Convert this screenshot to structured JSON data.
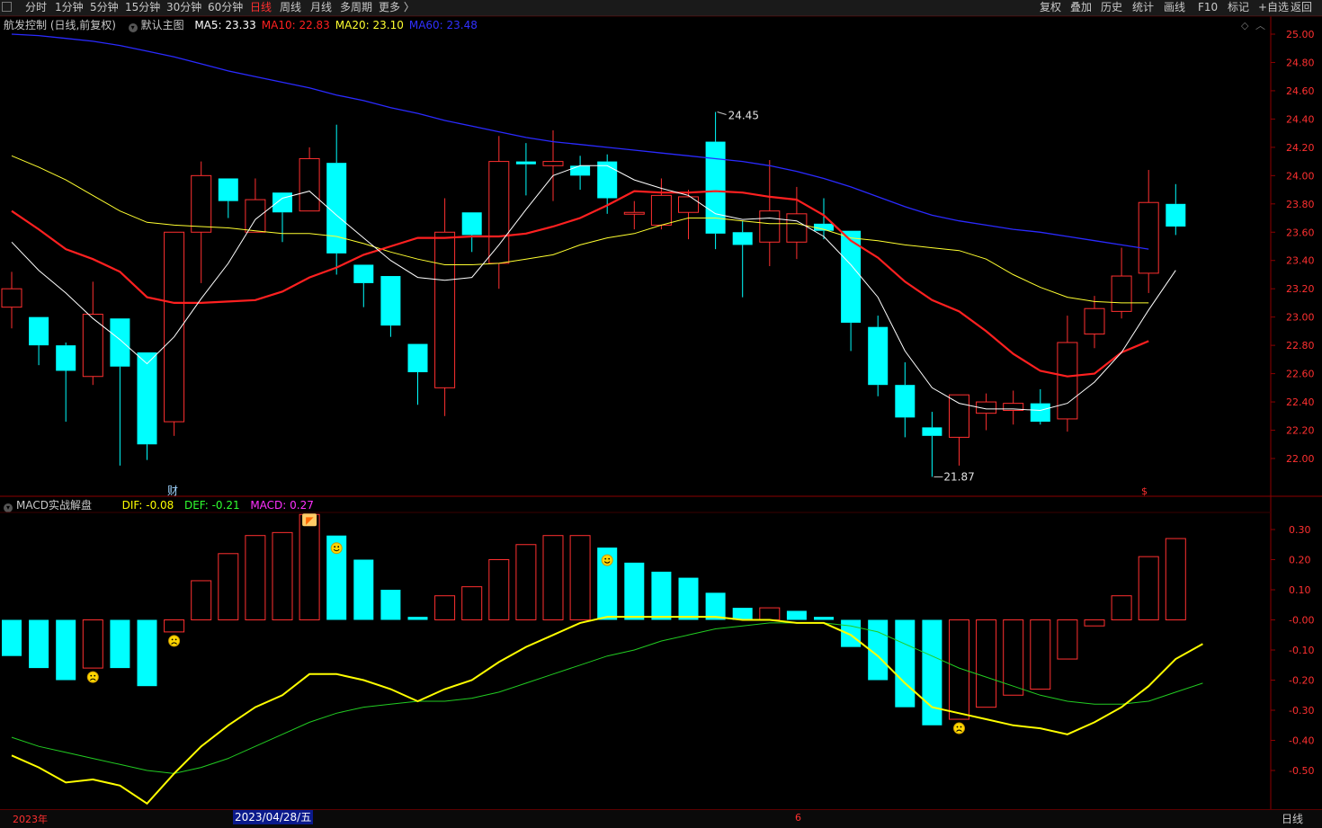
{
  "toolbar": {
    "left_items": [
      "分时",
      "1分钟",
      "5分钟",
      "15分钟",
      "30分钟",
      "60分钟",
      "日线",
      "周线",
      "月线",
      "多周期",
      "更多 〉"
    ],
    "active_index": 6,
    "right_items": [
      "复权",
      "叠加",
      "历史",
      "统计",
      "画线",
      "F10",
      "标记",
      "+自选",
      "返回"
    ]
  },
  "main_header": {
    "title": "航发控制 (日线,前复权)",
    "template": "默认主图",
    "ma": [
      {
        "label": "MA5: 23.33",
        "color": "#ffffff"
      },
      {
        "label": "MA10: 22.83",
        "color": "#ff2020"
      },
      {
        "label": "MA20: 23.10",
        "color": "#ffff30"
      },
      {
        "label": "MA60: 23.48",
        "color": "#3030ff"
      }
    ]
  },
  "sub_header": {
    "title": "MACD实战解盘",
    "dif": "DIF: -0.08",
    "def": "DEF: -0.21",
    "macd": "MACD: 0.27",
    "dif_color": "#ffff00",
    "def_color": "#30ff30",
    "macd_color": "#ff30ff"
  },
  "price_axis": [
    "25.00",
    "24.80",
    "24.60",
    "24.40",
    "24.20",
    "24.00",
    "23.80",
    "23.60",
    "23.40",
    "23.20",
    "23.00",
    "22.80",
    "22.60",
    "22.40",
    "22.20",
    "22.00"
  ],
  "macd_axis": [
    "0.30",
    "0.20",
    "0.10",
    "-0.00",
    "-0.10",
    "-0.20",
    "-0.30",
    "-0.40",
    "-0.50"
  ],
  "annotations": {
    "high": "24.45",
    "low": "21.87",
    "fin_marker": "财",
    "s_marker": "$"
  },
  "bottom_bar": {
    "year": "2023年",
    "cursor_date": "2023/04/28/五",
    "month": "6",
    "period": "日线"
  },
  "colors": {
    "up": "#ff3030",
    "down": "#00ffff",
    "ma5": "#ffffff",
    "ma10": "#ff2020",
    "ma20": "#ffff30",
    "ma60": "#2a2aff",
    "dif": "#ffff00",
    "def": "#22cc22",
    "bg": "#000000",
    "axis": "#8b0000",
    "axis_text": "#ff3030"
  },
  "chart_data": [
    {
      "type": "candlestick",
      "ylim": [
        21.7,
        25.1
      ],
      "candles": [
        {
          "o": 23.07,
          "h": 23.32,
          "l": 22.92,
          "c": 23.2
        },
        {
          "o": 23.0,
          "h": 23.0,
          "l": 22.66,
          "c": 22.8
        },
        {
          "o": 22.8,
          "h": 22.82,
          "l": 22.26,
          "c": 22.62
        },
        {
          "o": 22.58,
          "h": 23.25,
          "l": 22.52,
          "c": 23.02
        },
        {
          "o": 22.99,
          "h": 22.99,
          "l": 21.95,
          "c": 22.65
        },
        {
          "o": 22.75,
          "h": 22.75,
          "l": 21.99,
          "c": 22.1
        },
        {
          "o": 22.26,
          "h": 23.6,
          "l": 22.16,
          "c": 23.6
        },
        {
          "o": 23.6,
          "h": 24.1,
          "l": 23.24,
          "c": 24.0
        },
        {
          "o": 23.98,
          "h": 23.98,
          "l": 23.7,
          "c": 23.82
        },
        {
          "o": 23.6,
          "h": 23.98,
          "l": 23.6,
          "c": 23.83
        },
        {
          "o": 23.88,
          "h": 23.88,
          "l": 23.53,
          "c": 23.74
        },
        {
          "o": 23.75,
          "h": 24.2,
          "l": 23.75,
          "c": 24.12
        },
        {
          "o": 24.09,
          "h": 24.36,
          "l": 23.3,
          "c": 23.45
        },
        {
          "o": 23.37,
          "h": 23.37,
          "l": 23.07,
          "c": 23.24
        },
        {
          "o": 23.29,
          "h": 23.29,
          "l": 22.86,
          "c": 22.94
        },
        {
          "o": 22.81,
          "h": 22.81,
          "l": 22.38,
          "c": 22.61
        },
        {
          "o": 22.5,
          "h": 23.84,
          "l": 22.3,
          "c": 23.6
        },
        {
          "o": 23.74,
          "h": 23.74,
          "l": 23.46,
          "c": 23.58
        },
        {
          "o": 23.38,
          "h": 24.28,
          "l": 23.2,
          "c": 24.1
        },
        {
          "o": 24.1,
          "h": 24.23,
          "l": 23.86,
          "c": 24.08
        },
        {
          "o": 24.07,
          "h": 24.32,
          "l": 23.82,
          "c": 24.1
        },
        {
          "o": 24.07,
          "h": 24.14,
          "l": 23.9,
          "c": 24.0
        },
        {
          "o": 24.1,
          "h": 24.15,
          "l": 23.73,
          "c": 23.84
        },
        {
          "o": 23.73,
          "h": 23.82,
          "l": 23.62,
          "c": 23.74
        },
        {
          "o": 23.65,
          "h": 23.98,
          "l": 23.62,
          "c": 23.86
        },
        {
          "o": 23.74,
          "h": 23.9,
          "l": 23.55,
          "c": 23.85
        },
        {
          "o": 24.24,
          "h": 24.45,
          "l": 23.48,
          "c": 23.59
        },
        {
          "o": 23.6,
          "h": 23.68,
          "l": 23.14,
          "c": 23.51
        },
        {
          "o": 23.53,
          "h": 24.11,
          "l": 23.36,
          "c": 23.75
        },
        {
          "o": 23.53,
          "h": 23.92,
          "l": 23.41,
          "c": 23.73
        },
        {
          "o": 23.66,
          "h": 23.84,
          "l": 23.55,
          "c": 23.61
        },
        {
          "o": 23.61,
          "h": 23.61,
          "l": 22.76,
          "c": 22.96
        },
        {
          "o": 22.93,
          "h": 23.01,
          "l": 22.44,
          "c": 22.52
        },
        {
          "o": 22.52,
          "h": 22.68,
          "l": 22.15,
          "c": 22.29
        },
        {
          "o": 22.22,
          "h": 22.33,
          "l": 21.87,
          "c": 22.16
        },
        {
          "o": 22.15,
          "h": 22.45,
          "l": 21.95,
          "c": 22.45
        },
        {
          "o": 22.32,
          "h": 22.46,
          "l": 22.2,
          "c": 22.4
        },
        {
          "o": 22.34,
          "h": 22.48,
          "l": 22.24,
          "c": 22.39
        },
        {
          "o": 22.39,
          "h": 22.49,
          "l": 22.24,
          "c": 22.26
        },
        {
          "o": 22.28,
          "h": 23.01,
          "l": 22.19,
          "c": 22.82
        },
        {
          "o": 22.88,
          "h": 23.15,
          "l": 22.78,
          "c": 23.06
        },
        {
          "o": 23.04,
          "h": 23.49,
          "l": 22.99,
          "c": 23.29
        },
        {
          "o": 23.31,
          "h": 24.04,
          "l": 23.17,
          "c": 23.81
        },
        {
          "o": 23.8,
          "h": 23.94,
          "l": 23.58,
          "c": 23.64
        }
      ],
      "ma5": [
        23.53,
        23.33,
        23.17,
        22.99,
        22.84,
        22.67,
        22.86,
        23.13,
        23.38,
        23.69,
        23.84,
        23.89,
        23.72,
        23.56,
        23.4,
        23.28,
        23.26,
        23.28,
        23.51,
        23.76,
        24.0,
        24.07,
        24.07,
        23.97,
        23.91,
        23.86,
        23.73,
        23.69,
        23.7,
        23.68,
        23.57,
        23.37,
        23.14,
        22.76,
        22.5,
        22.39,
        22.35,
        22.35,
        22.34,
        22.39,
        22.54,
        22.75,
        23.05,
        23.33
      ],
      "ma10": [
        23.75,
        23.62,
        23.48,
        23.41,
        23.32,
        23.14,
        23.1,
        23.1,
        23.11,
        23.12,
        23.18,
        23.28,
        23.35,
        23.44,
        23.5,
        23.56,
        23.56,
        23.57,
        23.57,
        23.59,
        23.64,
        23.7,
        23.79,
        23.89,
        23.88,
        23.88,
        23.89,
        23.88,
        23.85,
        23.83,
        23.72,
        23.54,
        23.42,
        23.25,
        23.12,
        23.04,
        22.9,
        22.74,
        22.62,
        22.58,
        22.6,
        22.75,
        22.83
      ],
      "ma20": [
        24.14,
        24.06,
        23.97,
        23.86,
        23.75,
        23.67,
        23.65,
        23.64,
        23.63,
        23.61,
        23.59,
        23.59,
        23.57,
        23.52,
        23.46,
        23.41,
        23.37,
        23.37,
        23.38,
        23.41,
        23.44,
        23.51,
        23.56,
        23.59,
        23.65,
        23.7,
        23.7,
        23.68,
        23.66,
        23.66,
        23.62,
        23.56,
        23.54,
        23.51,
        23.49,
        23.47,
        23.41,
        23.3,
        23.21,
        23.14,
        23.11,
        23.1,
        23.1
      ],
      "ma60": [
        25.0,
        24.99,
        24.97,
        24.95,
        24.92,
        24.88,
        24.84,
        24.79,
        24.74,
        24.7,
        24.66,
        24.62,
        24.57,
        24.53,
        24.48,
        24.44,
        24.39,
        24.35,
        24.31,
        24.27,
        24.24,
        24.22,
        24.2,
        24.18,
        24.16,
        24.14,
        24.12,
        24.1,
        24.07,
        24.03,
        23.98,
        23.92,
        23.85,
        23.78,
        23.72,
        23.68,
        23.65,
        23.62,
        23.6,
        23.57,
        23.54,
        23.51,
        23.48
      ]
    },
    {
      "type": "macd",
      "ylim": [
        -0.6,
        0.36
      ],
      "macd": [
        -0.12,
        -0.16,
        -0.2,
        -0.16,
        -0.16,
        -0.22,
        -0.04,
        0.13,
        0.22,
        0.28,
        0.29,
        0.35,
        0.28,
        0.2,
        0.1,
        0.01,
        0.08,
        0.11,
        0.2,
        0.25,
        0.28,
        0.28,
        0.24,
        0.19,
        0.16,
        0.14,
        0.09,
        0.04,
        0.04,
        0.03,
        0.01,
        -0.09,
        -0.2,
        -0.29,
        -0.35,
        -0.33,
        -0.29,
        -0.25,
        -0.23,
        -0.13,
        -0.02,
        0.08,
        0.21,
        0.27
      ],
      "dif": [
        -0.45,
        -0.49,
        -0.54,
        -0.53,
        -0.55,
        -0.61,
        -0.51,
        -0.42,
        -0.35,
        -0.29,
        -0.25,
        -0.18,
        -0.18,
        -0.2,
        -0.23,
        -0.27,
        -0.23,
        -0.2,
        -0.14,
        -0.09,
        -0.05,
        -0.01,
        0.01,
        0.01,
        0.01,
        0.01,
        0.01,
        0.0,
        0.0,
        -0.01,
        -0.01,
        -0.05,
        -0.12,
        -0.21,
        -0.29,
        -0.31,
        -0.33,
        -0.35,
        -0.36,
        -0.38,
        -0.34,
        -0.29,
        -0.22,
        -0.13,
        -0.08
      ],
      "def": [
        -0.39,
        -0.42,
        -0.44,
        -0.46,
        -0.48,
        -0.5,
        -0.51,
        -0.49,
        -0.46,
        -0.42,
        -0.38,
        -0.34,
        -0.31,
        -0.29,
        -0.28,
        -0.27,
        -0.27,
        -0.26,
        -0.24,
        -0.21,
        -0.18,
        -0.15,
        -0.12,
        -0.1,
        -0.07,
        -0.05,
        -0.03,
        -0.02,
        -0.01,
        -0.01,
        -0.01,
        -0.02,
        -0.04,
        -0.08,
        -0.12,
        -0.16,
        -0.19,
        -0.22,
        -0.25,
        -0.27,
        -0.28,
        -0.28,
        -0.27,
        -0.24,
        -0.21
      ],
      "markers": [
        {
          "i": 3,
          "kind": "sad"
        },
        {
          "i": 6,
          "kind": "sad"
        },
        {
          "i": 11,
          "kind": "flag"
        },
        {
          "i": 12,
          "kind": "happy"
        },
        {
          "i": 22,
          "kind": "happy"
        },
        {
          "i": 35,
          "kind": "sad"
        }
      ]
    }
  ]
}
